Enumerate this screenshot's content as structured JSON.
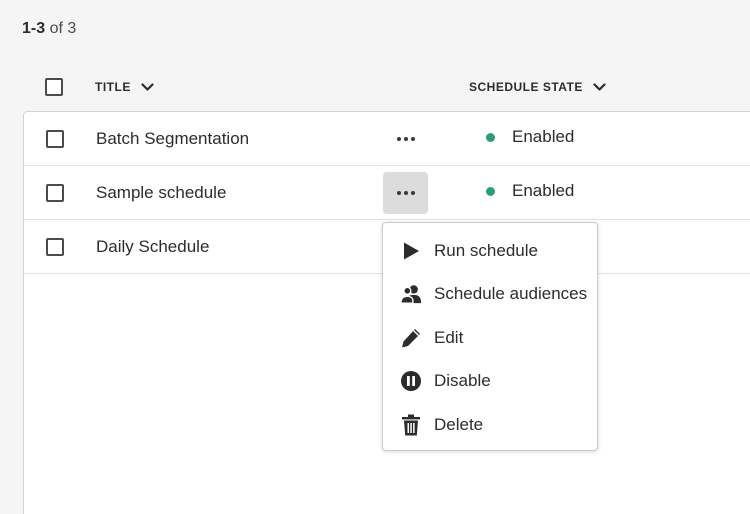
{
  "pagination": {
    "range": "1-3",
    "suffix": "of 3"
  },
  "columns": {
    "title": "TITLE",
    "schedule_state": "SCHEDULE STATE"
  },
  "rows": [
    {
      "title": "Batch Segmentation",
      "state": "Enabled"
    },
    {
      "title": "Sample schedule",
      "state": "Enabled"
    },
    {
      "title": "Daily Schedule",
      "state": ""
    }
  ],
  "menu": {
    "items": [
      {
        "label": "Run schedule",
        "icon": "play-icon"
      },
      {
        "label": "Schedule audiences",
        "icon": "users-icon"
      },
      {
        "label": "Edit",
        "icon": "pencil-icon"
      },
      {
        "label": "Disable",
        "icon": "pause-circle-icon"
      },
      {
        "label": "Delete",
        "icon": "trash-icon"
      }
    ]
  },
  "colors": {
    "enabled_status": "#2d9d78",
    "active_button_bg": "#dcdcdc"
  }
}
